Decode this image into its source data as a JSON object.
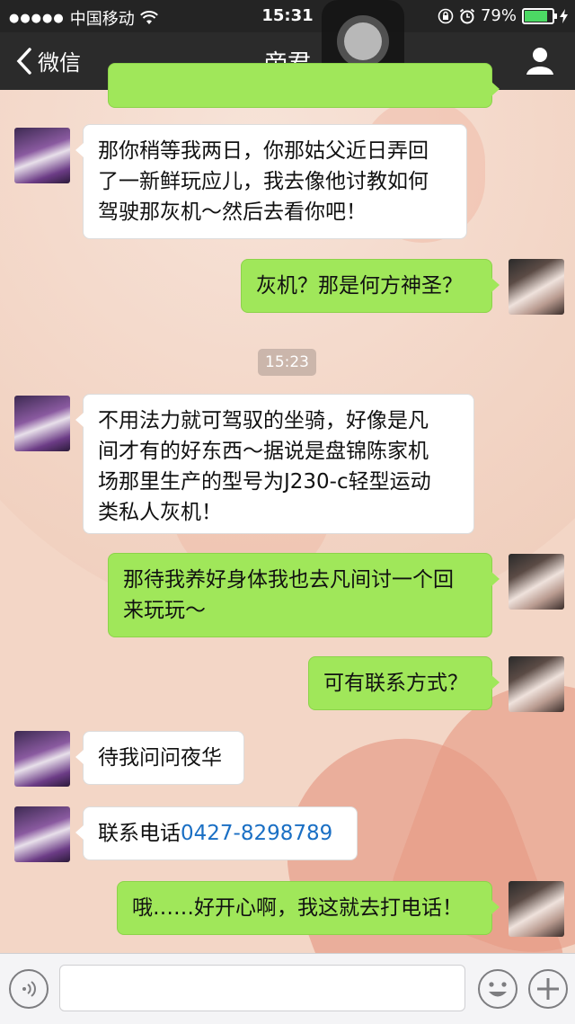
{
  "status_bar": {
    "carrier": "中国移动",
    "time": "15:31",
    "battery": "79%",
    "battery_level": 0.79
  },
  "nav": {
    "back_label": "微信",
    "title": "帝君"
  },
  "chat": {
    "timestamp": "15:23",
    "messages": [
      {
        "side": "right",
        "text": ""
      },
      {
        "side": "left",
        "lines": [
          "那你稍等我两日，你那姑父近日弄回",
          "了一新鲜玩应儿，我去像他讨教如何",
          "驾驶那灰机～然后去看你吧！"
        ]
      },
      {
        "side": "right",
        "text": "灰机？那是何方神圣？"
      },
      {
        "side": "left",
        "lines": [
          "不用法力就可驾驭的坐骑，好像是凡",
          "间才有的好东西～据说是盘锦陈家机",
          "场那里生产的型号为J230-c轻型运动",
          "类私人灰机！"
        ]
      },
      {
        "side": "right",
        "lines": [
          "那待我养好身体我也去凡间讨一个回",
          "来玩玩～"
        ]
      },
      {
        "side": "right",
        "text": "可有联系方式？"
      },
      {
        "side": "left",
        "text": "待我问问夜华"
      },
      {
        "side": "left",
        "prefix": "联系电话",
        "phone": "0427-8298789"
      },
      {
        "side": "right",
        "text": "哦……好开心啊，我这就去打电话！"
      }
    ]
  },
  "input_bar": {
    "placeholder": ""
  },
  "icons": {
    "wifi": "wifi-icon",
    "lock_rotation": "rotation-lock-icon",
    "alarm": "alarm-icon",
    "charging": "charging-bolt-icon",
    "back": "chevron-left-icon",
    "profile": "person-icon",
    "voice": "voice-icon",
    "emoji": "emoji-icon",
    "plus": "plus-icon"
  },
  "colors": {
    "bubble_green": "#a0e75a",
    "bubble_white": "#ffffff",
    "nav_bg": "#2b2b2b",
    "phone_link": "#1a6fc4",
    "battery_fill": "#4cd964"
  }
}
